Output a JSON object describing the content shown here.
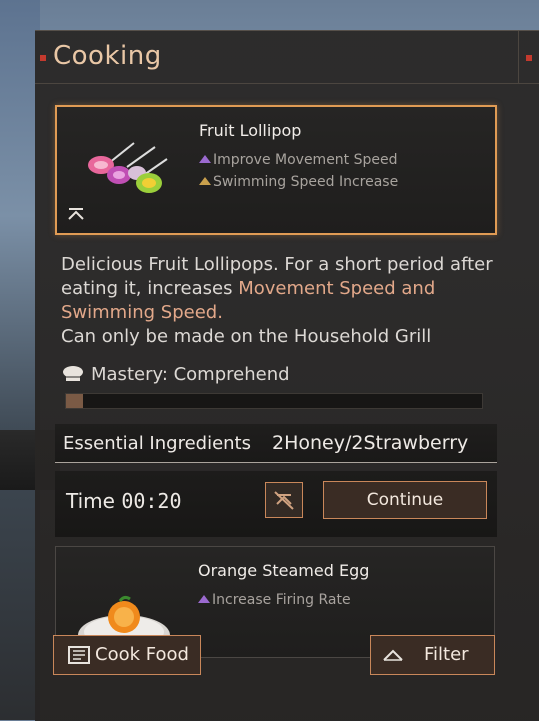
{
  "panel": {
    "title": "Cooking"
  },
  "selected_recipe": {
    "name": "Fruit Lollipop",
    "effects": [
      {
        "text": "Improve Movement Speed",
        "color": "#9b6ad0"
      },
      {
        "text": "Swimming Speed Increase",
        "color": "#c9a04d"
      }
    ],
    "description_line1": "Delicious Fruit Lollipops. For a short period after eating it, increases ",
    "description_highlight": "Movement Speed and Swimming Speed",
    "description_end": ".",
    "description_line2": "Can only be made on the Household Grill",
    "mastery": "Mastery: Comprehend",
    "mastery_progress": 0.04,
    "ingredients_label": "Essential Ingredients",
    "ingredients_value": "2Honey/2Strawberry",
    "time_label": "Time",
    "time_value": "00:20",
    "continue_label": "Continue"
  },
  "next_recipe": {
    "name": "Orange Steamed Egg",
    "effect": "Increase Firing Rate"
  },
  "footer": {
    "cook_food_label": "Cook Food",
    "filter_label": "Filter"
  },
  "colors": {
    "accent": "#e09b54",
    "button_border": "#c9875a",
    "highlight_text": "#e2a88a"
  }
}
